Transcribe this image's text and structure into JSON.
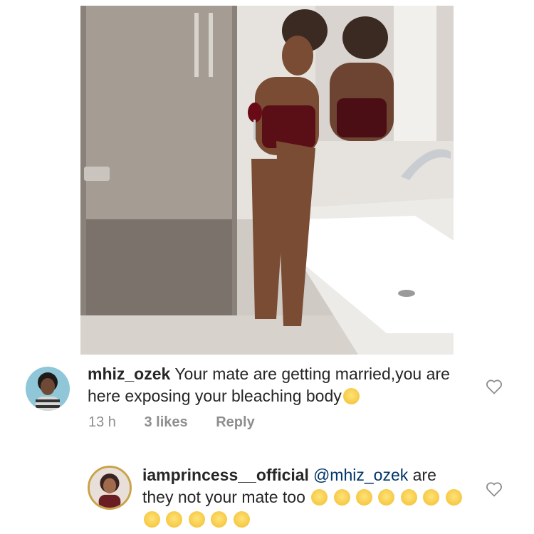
{
  "post": {
    "image_description_icon": "bathroom-photo"
  },
  "comments": [
    {
      "username": "mhiz_ozek",
      "text": "Your mate are getting married,you are here exposing your bleaching body",
      "emoji": "rolling-eyes-face-emoji",
      "meta": {
        "time": "13 h",
        "likes": "3 likes",
        "reply": "Reply"
      }
    },
    {
      "username": "iamprincess__official",
      "mention": "@mhiz_ozek",
      "text": "are they not your mate too",
      "emoji_count": 12,
      "emoji": "loudly-crying-face-emoji"
    }
  ],
  "colors": {
    "mention": "#003569",
    "meta": "#8e8e8e",
    "text": "#262626",
    "heart": "#8e8e8e",
    "emoji_yellow": "#f7c843"
  }
}
